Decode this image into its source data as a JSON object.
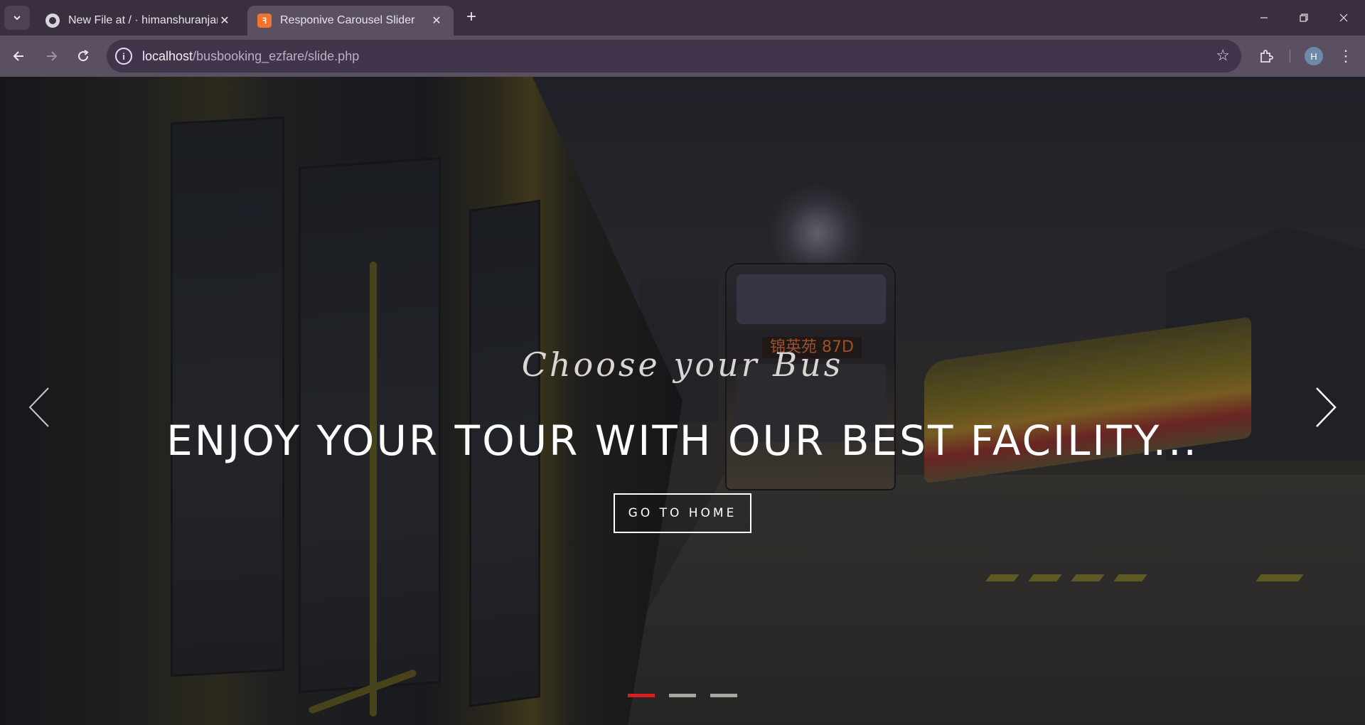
{
  "browser": {
    "tabs": [
      {
        "title": "New File at / · himanshuranjan9",
        "favicon": "github-icon",
        "active": false
      },
      {
        "title": "Responive Carousel Slider",
        "favicon": "xampp-icon",
        "active": true
      }
    ],
    "url_host": "localhost",
    "url_path": "/busbooking_ezfare/slide.php",
    "profile_initial": "H"
  },
  "carousel": {
    "subtitle": "Choose your Bus",
    "headline": "ENJOY YOUR TOUR WITH OUR BEST FACILITY...",
    "cta_label": "GO TO HOME",
    "bus_sign": "锦英苑 87D",
    "slide_count": 3,
    "active_index": 0,
    "colors": {
      "indicator_active": "#d81f1f",
      "indicator_inactive": "#a8a6a2"
    }
  }
}
